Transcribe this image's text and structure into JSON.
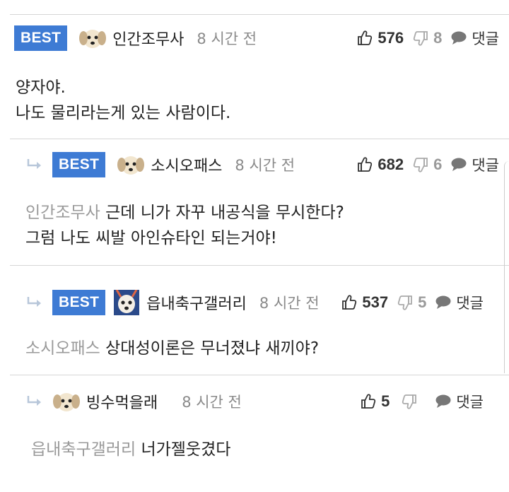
{
  "comments": [
    {
      "badge": "BEST",
      "author": "인간조무사",
      "time": "8 시간 전",
      "likes": "576",
      "dislikes": "8",
      "reply_label": "댓글",
      "mention": "",
      "lines": [
        "양자야.",
        "나도 물리라는게 있는 사람이다."
      ]
    },
    {
      "badge": "BEST",
      "author": "소시오패스",
      "time": "8 시간 전",
      "likes": "682",
      "dislikes": "6",
      "reply_label": "댓글",
      "mention": "인간조무사",
      "lines": [
        "근데 니가 자꾸 내공식을 무시한다?",
        "그럼 나도 씨발 아인슈타인 되는거야!"
      ]
    },
    {
      "badge": "BEST",
      "author": "읍내축구갤러리",
      "time": "8 시간 전",
      "likes": "537",
      "dislikes": "5",
      "reply_label": "댓글",
      "mention": "소시오패스",
      "lines": [
        "상대성이론은 무너졌냐 새끼야?"
      ]
    },
    {
      "badge": "",
      "author": "빙수먹을래",
      "time": "8 시간 전",
      "likes": "5",
      "dislikes": "",
      "reply_label": "댓글",
      "mention": "읍내축구갤러리",
      "lines": [
        "너가젤웃겼다"
      ]
    }
  ],
  "icons": {
    "like": "thumbs-up-icon",
    "dislike": "thumbs-down-icon",
    "reply": "speech-bubble-icon",
    "reply_arrow": "reply-arrow-icon"
  },
  "colors": {
    "badge": "#3e7bd4",
    "mention": "#9a9a9a",
    "divider": "#d6d6d6"
  }
}
